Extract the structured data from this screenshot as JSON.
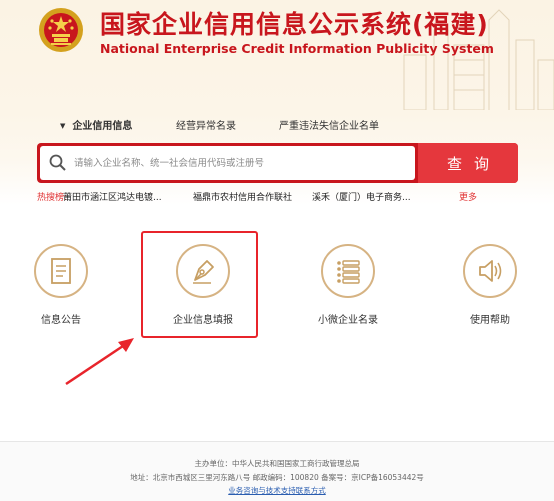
{
  "header": {
    "title": "国家企业信用信息公示系统(福建)",
    "subtitle": "National Enterprise Credit Information Publicity System"
  },
  "tabs": [
    {
      "label": "企业信用信息",
      "active": true
    },
    {
      "label": "经营异常名录",
      "active": false
    },
    {
      "label": "严重违法失信企业名单",
      "active": false
    }
  ],
  "search": {
    "placeholder": "请输入企业名称、统一社会信用代码或注册号",
    "value": "",
    "button_label": "查询"
  },
  "hot_search": {
    "label": "热搜榜:",
    "items": [
      "莆田市涵江区鸿达电镀...",
      "福鼎市农村信用合作联社",
      "溪禾（厦门）电子商务..."
    ],
    "more_label": "更多"
  },
  "functions": [
    {
      "label": "信息公告",
      "icon": "document-icon"
    },
    {
      "label": "企业信息填报",
      "icon": "pen-nib-icon",
      "highlighted": true
    },
    {
      "label": "小微企业名录",
      "icon": "list-icon"
    },
    {
      "label": "使用帮助",
      "icon": "speaker-icon"
    }
  ],
  "footer": {
    "sponsor": "主办单位：中华人民共和国国家工商行政管理总局",
    "address": "地址：北京市西城区三里河东路八号  邮政编码：100820  备案号：京ICP备16053442号",
    "support_link": "业务咨询与技术支持联系方式"
  },
  "colors": {
    "brand_red": "#c8161d",
    "button_red": "#e5373d",
    "icon_gold": "#d6b383",
    "highlight_red": "#e8242b"
  }
}
